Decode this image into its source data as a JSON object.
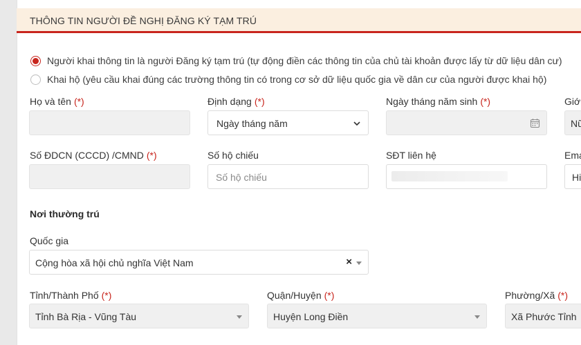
{
  "section": {
    "title": "THÔNG TIN NGƯỜI ĐỀ NGHỊ ĐĂNG KÝ TẠM TRÚ"
  },
  "options": {
    "self": "Người khai thông tin là người Đăng ký tạm trú (tự động điền các thông tin của chủ tài khoản được lấy từ dữ liệu dân cư)",
    "proxy": "Khai hộ (yêu cầu khai đúng các trường thông tin có trong cơ sở dữ liệu quốc gia về dân cư của người được khai hộ)"
  },
  "required_mark": "(*)",
  "fields": {
    "full_name": {
      "label": "Họ và tên"
    },
    "format": {
      "label": "Định dạng",
      "value": "Ngày tháng năm"
    },
    "dob": {
      "label": "Ngày tháng năm sinh"
    },
    "gender": {
      "label": "Giới",
      "value": "Nữ"
    },
    "id_number": {
      "label": "Số ĐDCN (CCCD) /CMND"
    },
    "passport": {
      "label": "Số hộ chiếu",
      "placeholder": "Số hộ chiếu"
    },
    "phone": {
      "label": "SĐT liên hệ"
    },
    "email": {
      "label": "Ema",
      "value": "Hi"
    }
  },
  "residence": {
    "title": "Nơi thường trú",
    "country": {
      "label": "Quốc gia",
      "value": "Cộng hòa xã hội chủ nghĩa Việt Nam",
      "clear": "×"
    },
    "province": {
      "label": "Tỉnh/Thành Phố",
      "value": "Tỉnh Bà Rịa - Vũng Tàu"
    },
    "district": {
      "label": "Quận/Huyện",
      "value": "Huyện Long Điền"
    },
    "ward": {
      "label": "Phường/Xã",
      "value": "Xã Phước Tỉnh"
    }
  },
  "colors": {
    "accent": "#c8251d",
    "header_bg": "#fbefe0"
  }
}
